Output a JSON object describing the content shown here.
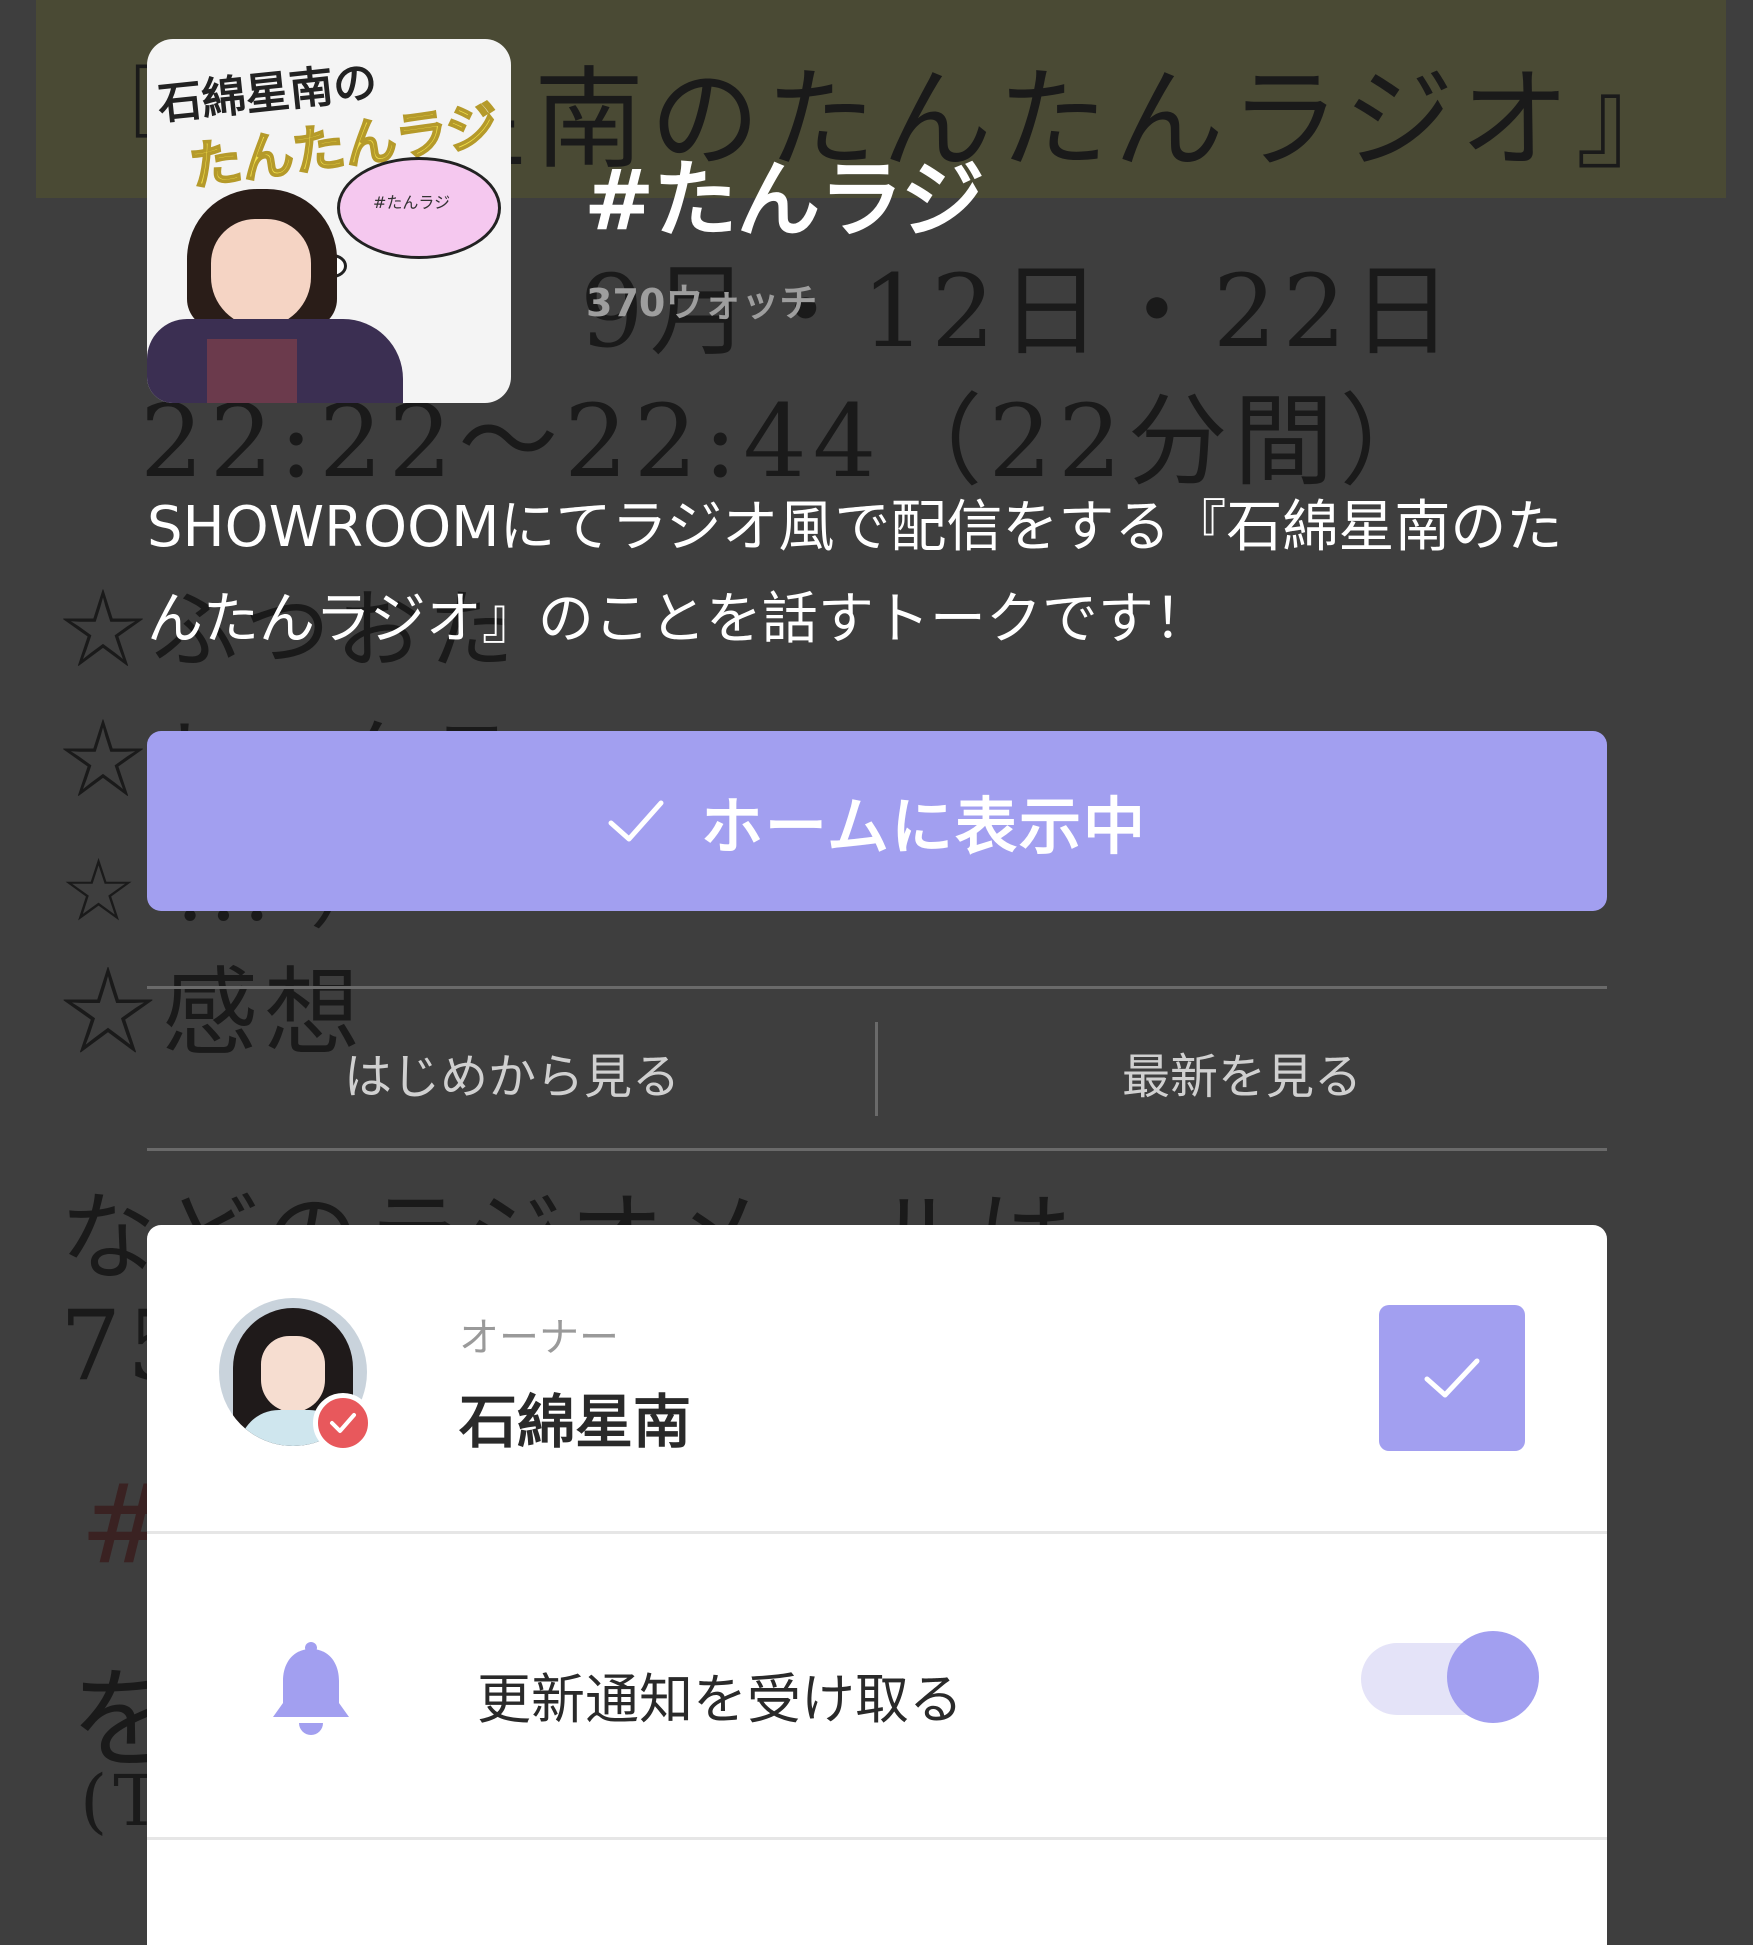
{
  "background_note": {
    "lines": [
      "『石綿星南のたんたんラジオ』",
      "9月・12日・22日",
      "22:22〜22:44（22分間）",
      "☆ふつおた",
      "☆トークテーマ",
      "☆ ... ）",
      "☆感想",
      "などのラジオメールは",
      "75",
      "#",
      "を                              !",
      "(T"
    ]
  },
  "thumbnail": {
    "line1": "石綿星南の",
    "line2": "たんたんラジオ",
    "cloud_text": "#たんラジ"
  },
  "header": {
    "title": "#たんラジ",
    "watch_count": "370ウォッチ"
  },
  "description": "SHOWROOMにてラジオ風で配信をする『石綿星南のたんたんラジオ』のことを話すトークです！",
  "home_button": {
    "label": "ホームに表示中",
    "icon": "check-icon"
  },
  "tabs": [
    {
      "label": "はじめから見る"
    },
    {
      "label": "最新を見る"
    }
  ],
  "owner": {
    "role_label": "オーナー",
    "name": "石綿星南",
    "follow_icon": "check-icon",
    "badge_icon": "verified-check-icon"
  },
  "notification": {
    "label": "更新通知を受け取る",
    "icon": "bell-icon",
    "enabled": true
  },
  "colors": {
    "accent": "#a29ff0",
    "background": "#3e3e3e",
    "badge": "#e8585c"
  }
}
